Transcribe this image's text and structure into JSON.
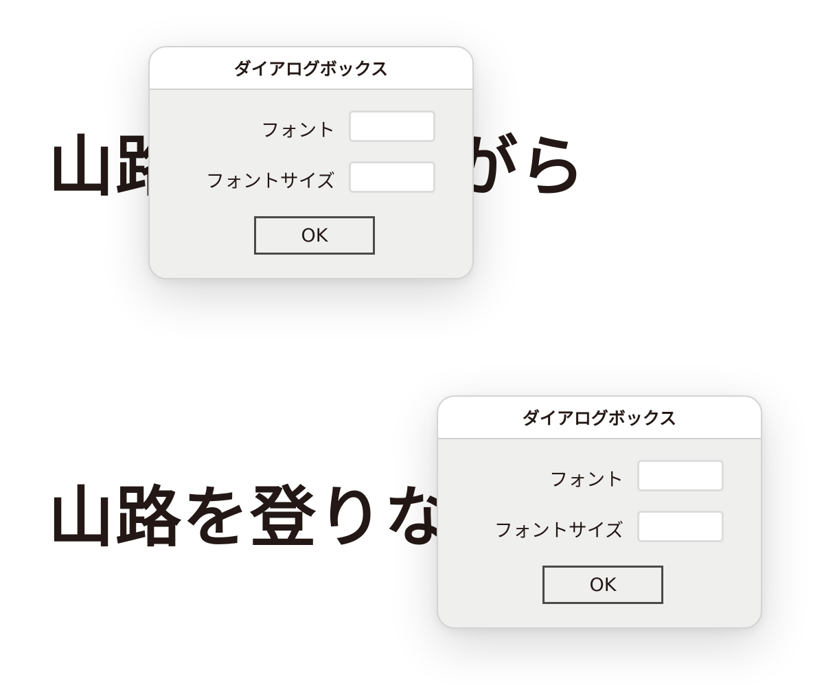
{
  "background": {
    "text_top": "山路を登りながら",
    "text_bottom_visible": "山路を登りな",
    "text_bottom_faded": "がら",
    "text_color": "#231815",
    "faded_color": "#e8e8e8"
  },
  "dialogs": [
    {
      "title": "ダイアログボックス",
      "font_label": "フォント",
      "font_value": "",
      "size_label": "フォントサイズ",
      "size_value": "",
      "ok_label": "OK"
    },
    {
      "title": "ダイアログボックス",
      "font_label": "フォント",
      "font_value": "",
      "size_label": "フォントサイズ",
      "size_value": "",
      "ok_label": "OK"
    }
  ],
  "colors": {
    "dialog_body": "#efefee",
    "titlebar": "#ffffff",
    "button_border": "#4a4a4a"
  }
}
